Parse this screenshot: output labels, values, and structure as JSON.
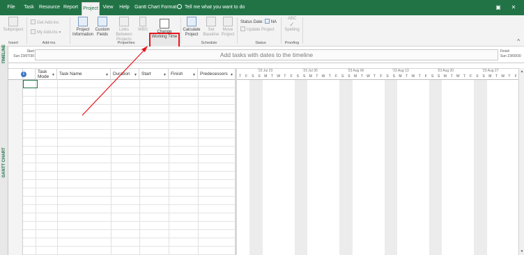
{
  "tabs": [
    {
      "label": "File",
      "active": false
    },
    {
      "label": "Task",
      "active": false
    },
    {
      "label": "Resource",
      "active": false
    },
    {
      "label": "Report",
      "active": false
    },
    {
      "label": "Project",
      "active": true
    },
    {
      "label": "View",
      "active": false
    },
    {
      "label": "Help",
      "active": false
    },
    {
      "label": "Gantt Chart Format",
      "active": false
    }
  ],
  "tell_me": "Tell me what you want to do",
  "ribbon": {
    "insert": {
      "subproject": "Subproject",
      "group": "Insert"
    },
    "addins": {
      "get_addins": "Get Add-ins",
      "my_addins": "My Add-ins",
      "group": "Add-ins"
    },
    "properties": {
      "project_information": [
        "Project",
        "Information"
      ],
      "custom_fields": [
        "Custom",
        "Fields"
      ],
      "links_between_projects": [
        "Links Between",
        "Projects"
      ],
      "wbs": "WBS",
      "change_working_time": [
        "Change",
        "Working Time"
      ],
      "group": "Properties"
    },
    "schedule": {
      "calculate_project": [
        "Calculate",
        "Project"
      ],
      "set_baseline": [
        "Set",
        "Baseline"
      ],
      "move_project": [
        "Move",
        "Project"
      ],
      "group": "Schedule"
    },
    "status": {
      "status_date": "Status Date:",
      "status_value": "NA",
      "update_project": "Update Project",
      "group": "Status"
    },
    "proofing": {
      "abc": "ABC",
      "spelling": "Spelling",
      "group": "Proofing"
    }
  },
  "timeline": {
    "side_label": "TIMELINE",
    "start_label": "Start",
    "start_date": "Sun 23/07/30",
    "placeholder": "Add tasks with dates to the timeline",
    "finish_label": "Finish",
    "finish_date": "Sun 23/09/30"
  },
  "view_label": "GANTT CHART",
  "grid": {
    "info_symbol": "i",
    "columns": [
      "Task Mode",
      "Task Name",
      "Duration",
      "Start",
      "Finish",
      "Predecessors"
    ]
  },
  "gantt": {
    "weeks": [
      "'23 Jul 23",
      "'23 Jul 30",
      "'23 Aug 06",
      "'23 Aug 13",
      "'23 Aug 20",
      "'23 Aug 27"
    ],
    "day_letters": [
      "T",
      "F",
      "S",
      "S",
      "M",
      "T",
      "W",
      "T",
      "F",
      "S",
      "S",
      "M",
      "T",
      "W",
      "T",
      "F",
      "S",
      "S",
      "M",
      "T",
      "W",
      "T",
      "F",
      "S",
      "S",
      "M",
      "T",
      "W",
      "T",
      "F",
      "S",
      "S",
      "M",
      "T",
      "W",
      "T",
      "F",
      "S",
      "S",
      "M",
      "T",
      "W",
      "T",
      "F"
    ]
  },
  "colors": {
    "accent": "#217346",
    "highlight": "#e6151b"
  }
}
